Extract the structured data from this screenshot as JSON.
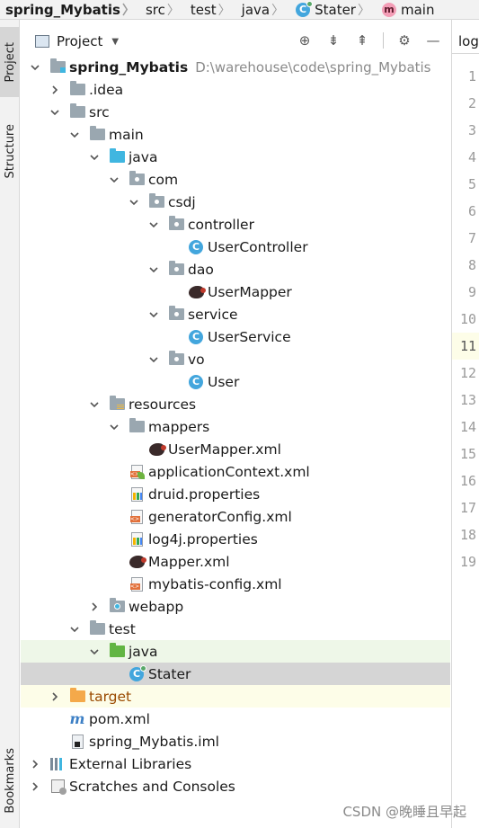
{
  "breadcrumb": {
    "items": [
      {
        "label": "spring_Mybatis",
        "icon": "none"
      },
      {
        "label": "src",
        "icon": "none"
      },
      {
        "label": "test",
        "icon": "none"
      },
      {
        "label": "java",
        "icon": "none"
      },
      {
        "label": "Stater",
        "icon": "run-class-icon"
      },
      {
        "label": "main",
        "icon": "method-icon"
      }
    ]
  },
  "left_strip": {
    "project_tab": "Project",
    "structure_tab": "Structure",
    "bookmarks_tab": "Bookmarks"
  },
  "tool_window": {
    "title": "Project",
    "actions": [
      "locate-icon",
      "expand-all-icon",
      "collapse-all-icon",
      "gear-icon",
      "hide-icon"
    ]
  },
  "tree": [
    {
      "label": "spring_Mybatis",
      "path": "D:\\warehouse\\code\\spring_Mybatis",
      "icon": "module-folder-icon",
      "expanded": true,
      "bold": true
    },
    {
      "label": ".idea",
      "icon": "folder-icon",
      "expanded": false
    },
    {
      "label": "src",
      "icon": "folder-icon",
      "expanded": true
    },
    {
      "label": "main",
      "icon": "folder-icon",
      "expanded": true
    },
    {
      "label": "java",
      "icon": "source-folder-icon",
      "expanded": true
    },
    {
      "label": "com",
      "icon": "package-icon",
      "expanded": true
    },
    {
      "label": "csdj",
      "icon": "package-icon",
      "expanded": true
    },
    {
      "label": "controller",
      "icon": "package-icon",
      "expanded": true
    },
    {
      "label": "UserController",
      "icon": "class-icon"
    },
    {
      "label": "dao",
      "icon": "package-icon",
      "expanded": true
    },
    {
      "label": "UserMapper",
      "icon": "mybatis-mapper-icon"
    },
    {
      "label": "service",
      "icon": "package-icon",
      "expanded": true
    },
    {
      "label": "UserService",
      "icon": "class-icon"
    },
    {
      "label": "vo",
      "icon": "package-icon",
      "expanded": true
    },
    {
      "label": "User",
      "icon": "class-icon"
    },
    {
      "label": "resources",
      "icon": "resources-folder-icon",
      "expanded": true
    },
    {
      "label": "mappers",
      "icon": "folder-icon",
      "expanded": true
    },
    {
      "label": "UserMapper.xml",
      "icon": "mybatis-mapper-icon"
    },
    {
      "label": "applicationContext.xml",
      "icon": "spring-xml-icon"
    },
    {
      "label": "druid.properties",
      "icon": "properties-icon"
    },
    {
      "label": "generatorConfig.xml",
      "icon": "xml-icon"
    },
    {
      "label": "log4j.properties",
      "icon": "properties-icon"
    },
    {
      "label": "Mapper.xml",
      "icon": "mybatis-mapper-icon"
    },
    {
      "label": "mybatis-config.xml",
      "icon": "xml-icon"
    },
    {
      "label": "webapp",
      "icon": "web-folder-icon",
      "expanded": false
    },
    {
      "label": "test",
      "icon": "folder-icon",
      "expanded": true
    },
    {
      "label": "java",
      "icon": "test-folder-icon",
      "expanded": true
    },
    {
      "label": "Stater",
      "icon": "run-class-icon",
      "selected": true
    },
    {
      "label": "target",
      "icon": "excluded-folder-icon",
      "expanded": false
    },
    {
      "label": "pom.xml",
      "icon": "maven-icon"
    },
    {
      "label": "spring_Mybatis.iml",
      "icon": "iml-icon"
    },
    {
      "label": "External Libraries",
      "icon": "libraries-icon",
      "expanded": false
    },
    {
      "label": "Scratches and Consoles",
      "icon": "scratches-icon",
      "expanded": false
    }
  ],
  "editor": {
    "tab_label": "log",
    "line_numbers": [
      "1",
      "2",
      "3",
      "4",
      "5",
      "6",
      "7",
      "8",
      "9",
      "10",
      "11",
      "12",
      "13",
      "14",
      "15",
      "16",
      "17",
      "18",
      "19"
    ],
    "current_line": "11"
  },
  "watermark": "CSDN @晚睡且早起"
}
